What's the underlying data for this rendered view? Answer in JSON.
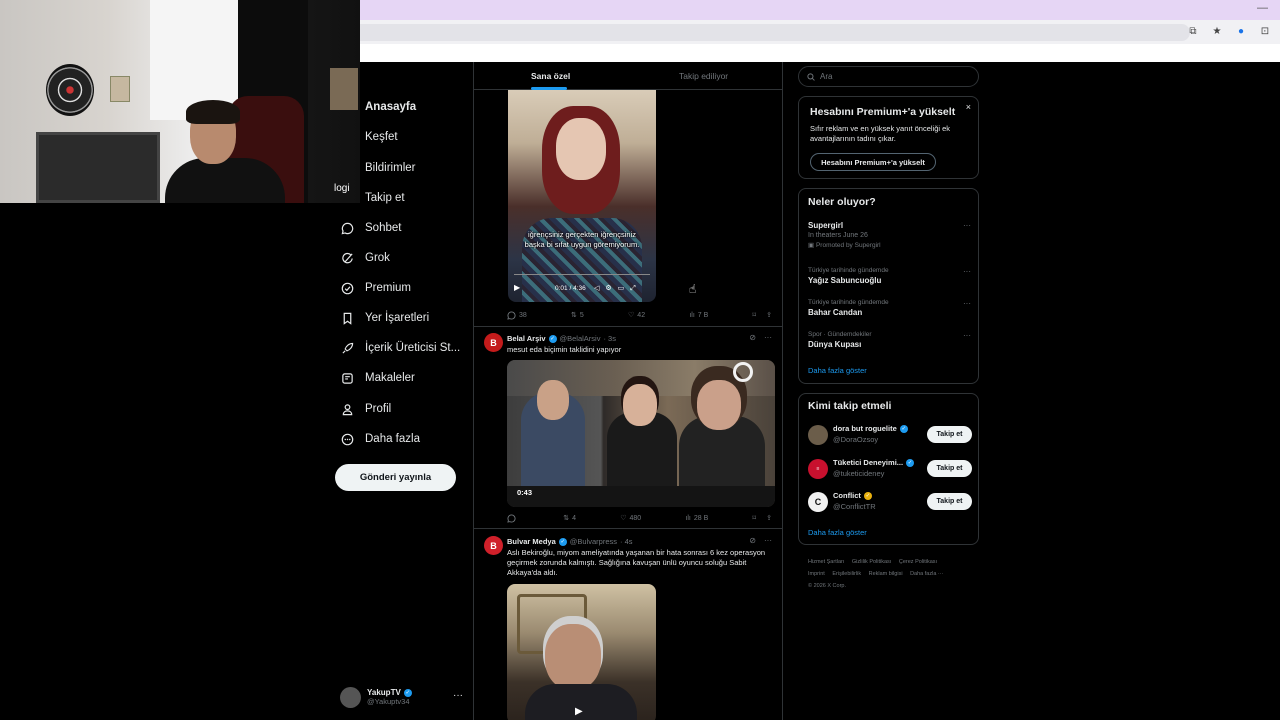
{
  "nav": {
    "logo_text": "logi",
    "items": [
      {
        "label": "Anasayfa",
        "icon": "home-icon"
      },
      {
        "label": "Keşfet",
        "icon": "search-icon"
      },
      {
        "label": "Bildirimler",
        "icon": "bell-icon"
      },
      {
        "label": "Takip et",
        "icon": "follow-icon"
      },
      {
        "label": "Sohbet",
        "icon": "chat-icon"
      },
      {
        "label": "Grok",
        "icon": "grok-icon"
      },
      {
        "label": "Premium",
        "icon": "premium-icon"
      },
      {
        "label": "Yer İşaretleri",
        "icon": "bookmark-icon"
      },
      {
        "label": "İçerik Üreticisi St...",
        "icon": "rocket-icon"
      },
      {
        "label": "Makaleler",
        "icon": "article-icon"
      },
      {
        "label": "Profil",
        "icon": "person-icon"
      },
      {
        "label": "Daha fazla",
        "icon": "more-circle-icon"
      }
    ],
    "post_button": "Gönderi yayınla"
  },
  "account": {
    "name": "YakupTV",
    "handle": "@Yakuptv34",
    "more": "···"
  },
  "timeline": {
    "tabs": {
      "for_you": "Sana özel",
      "following": "Takip ediliyor"
    },
    "tweet1": {
      "caption": "iğrençsiniz gerçekten iğrençsiniz başka bi sıfat uygun göremiyorum.",
      "time": "0:01 / 4:36",
      "actions": {
        "replies": "38",
        "reposts": "5",
        "likes": "42",
        "views": "7 B"
      }
    },
    "tweet2": {
      "name": "Belal Arşiv",
      "handle": "@BelalArsiv",
      "age": "· 3s",
      "text": "mesut eda biçimin taklidini yapıyor",
      "duration": "0:43",
      "actions": {
        "replies": "",
        "reposts": "4",
        "likes": "480",
        "views": "28 B"
      }
    },
    "tweet3": {
      "name": "Bulvar Medya",
      "handle": "@Bulvarpress",
      "age": "· 4s",
      "text": "Aslı Bekiroğlu, miyom ameliyatında yaşanan bir hata sonrası 6 kez operasyon geçirmek zorunda kalmıştı. Sağlığına kavuşan ünlü oyuncu soluğu Sabit Akkaya'da aldı."
    }
  },
  "sidebar": {
    "search_placeholder": "Ara",
    "premium": {
      "title": "Hesabını Premium+'a yükselt",
      "body": "Sıfır reklam ve en yüksek yanıt önceliği ek avantajlarının tadını çıkar.",
      "button": "Hesabını Premium+'a yükselt",
      "close": "×"
    },
    "trends": {
      "title": "Neler oluyor?",
      "items": [
        {
          "context": "",
          "name": "Supergirl",
          "sub": "In theaters June 26",
          "promo": "Promoted by Supergirl"
        },
        {
          "context": "Türkiye tarihinde gündemde",
          "name": "Yağız Sabuncuoğlu"
        },
        {
          "context": "Türkiye tarihinde gündemde",
          "name": "Bahar Candan"
        },
        {
          "context": "Spor · Gündemdekiler",
          "name": "Dünya Kupası"
        }
      ],
      "more": "Daha fazla göster"
    },
    "who_to_follow": {
      "title": "Kimi takip etmeli",
      "users": [
        {
          "name": "dora but roguelite",
          "handle": "@DoraOzsoy",
          "button": "Takip et"
        },
        {
          "name": "Tüketici Deneyimi...",
          "handle": "@tuketicideney",
          "button": "Takip et"
        },
        {
          "name": "Conflict",
          "handle": "@ConflictTR",
          "button": "Takip et"
        }
      ],
      "more": "Daha fazla göster"
    },
    "footer": [
      "Hizmet Şartları",
      "Gizlilik Politikası",
      "Çerez Politikası",
      "Imprint",
      "Erişilebilirlik",
      "Reklam bilgisi",
      "Daha fazla ···",
      "© 2026 X Corp."
    ]
  },
  "colors": {
    "accent": "#1d9bf0",
    "background": "#000000",
    "border": "#2f3336",
    "muted": "#71767b"
  }
}
